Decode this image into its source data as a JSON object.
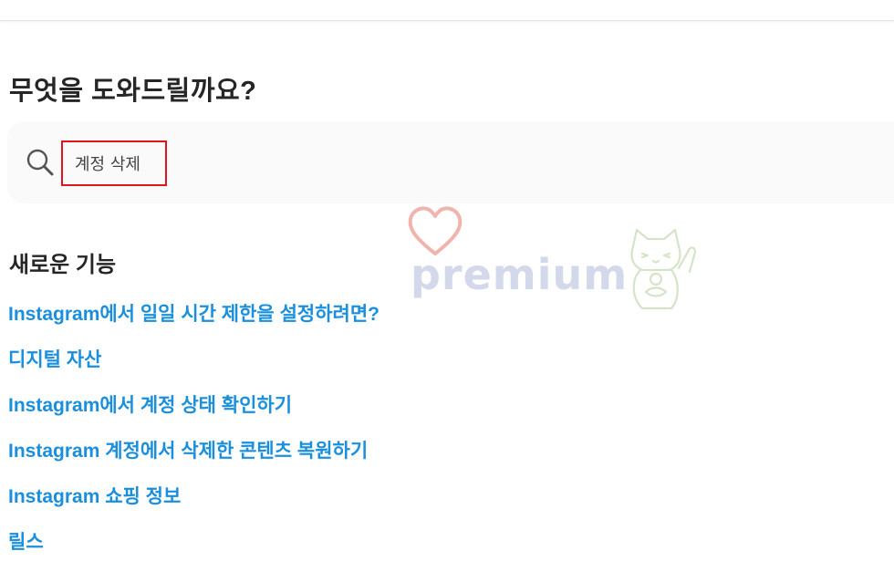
{
  "help": {
    "heading": "무엇을 도와드릴까요?",
    "search": {
      "value": "계정 삭제",
      "placeholder": ""
    }
  },
  "features": {
    "heading": "새로운 기능",
    "links": [
      "Instagram에서 일일 시간 제한을 설정하려면?",
      "디지털 자산",
      "Instagram에서 계정 상태 확인하기",
      "Instagram 계정에서 삭제한 콘텐츠 복원하기",
      "Instagram 쇼핑 정보",
      "릴스"
    ]
  },
  "watermark": {
    "text": "premium",
    "heart_icon": "heart-icon",
    "cat_icon": "lucky-cat-icon"
  },
  "colors": {
    "link": "#1a8fdd",
    "heading": "#262626",
    "search_bg": "#fafafa",
    "highlight_border": "#e0141e"
  }
}
